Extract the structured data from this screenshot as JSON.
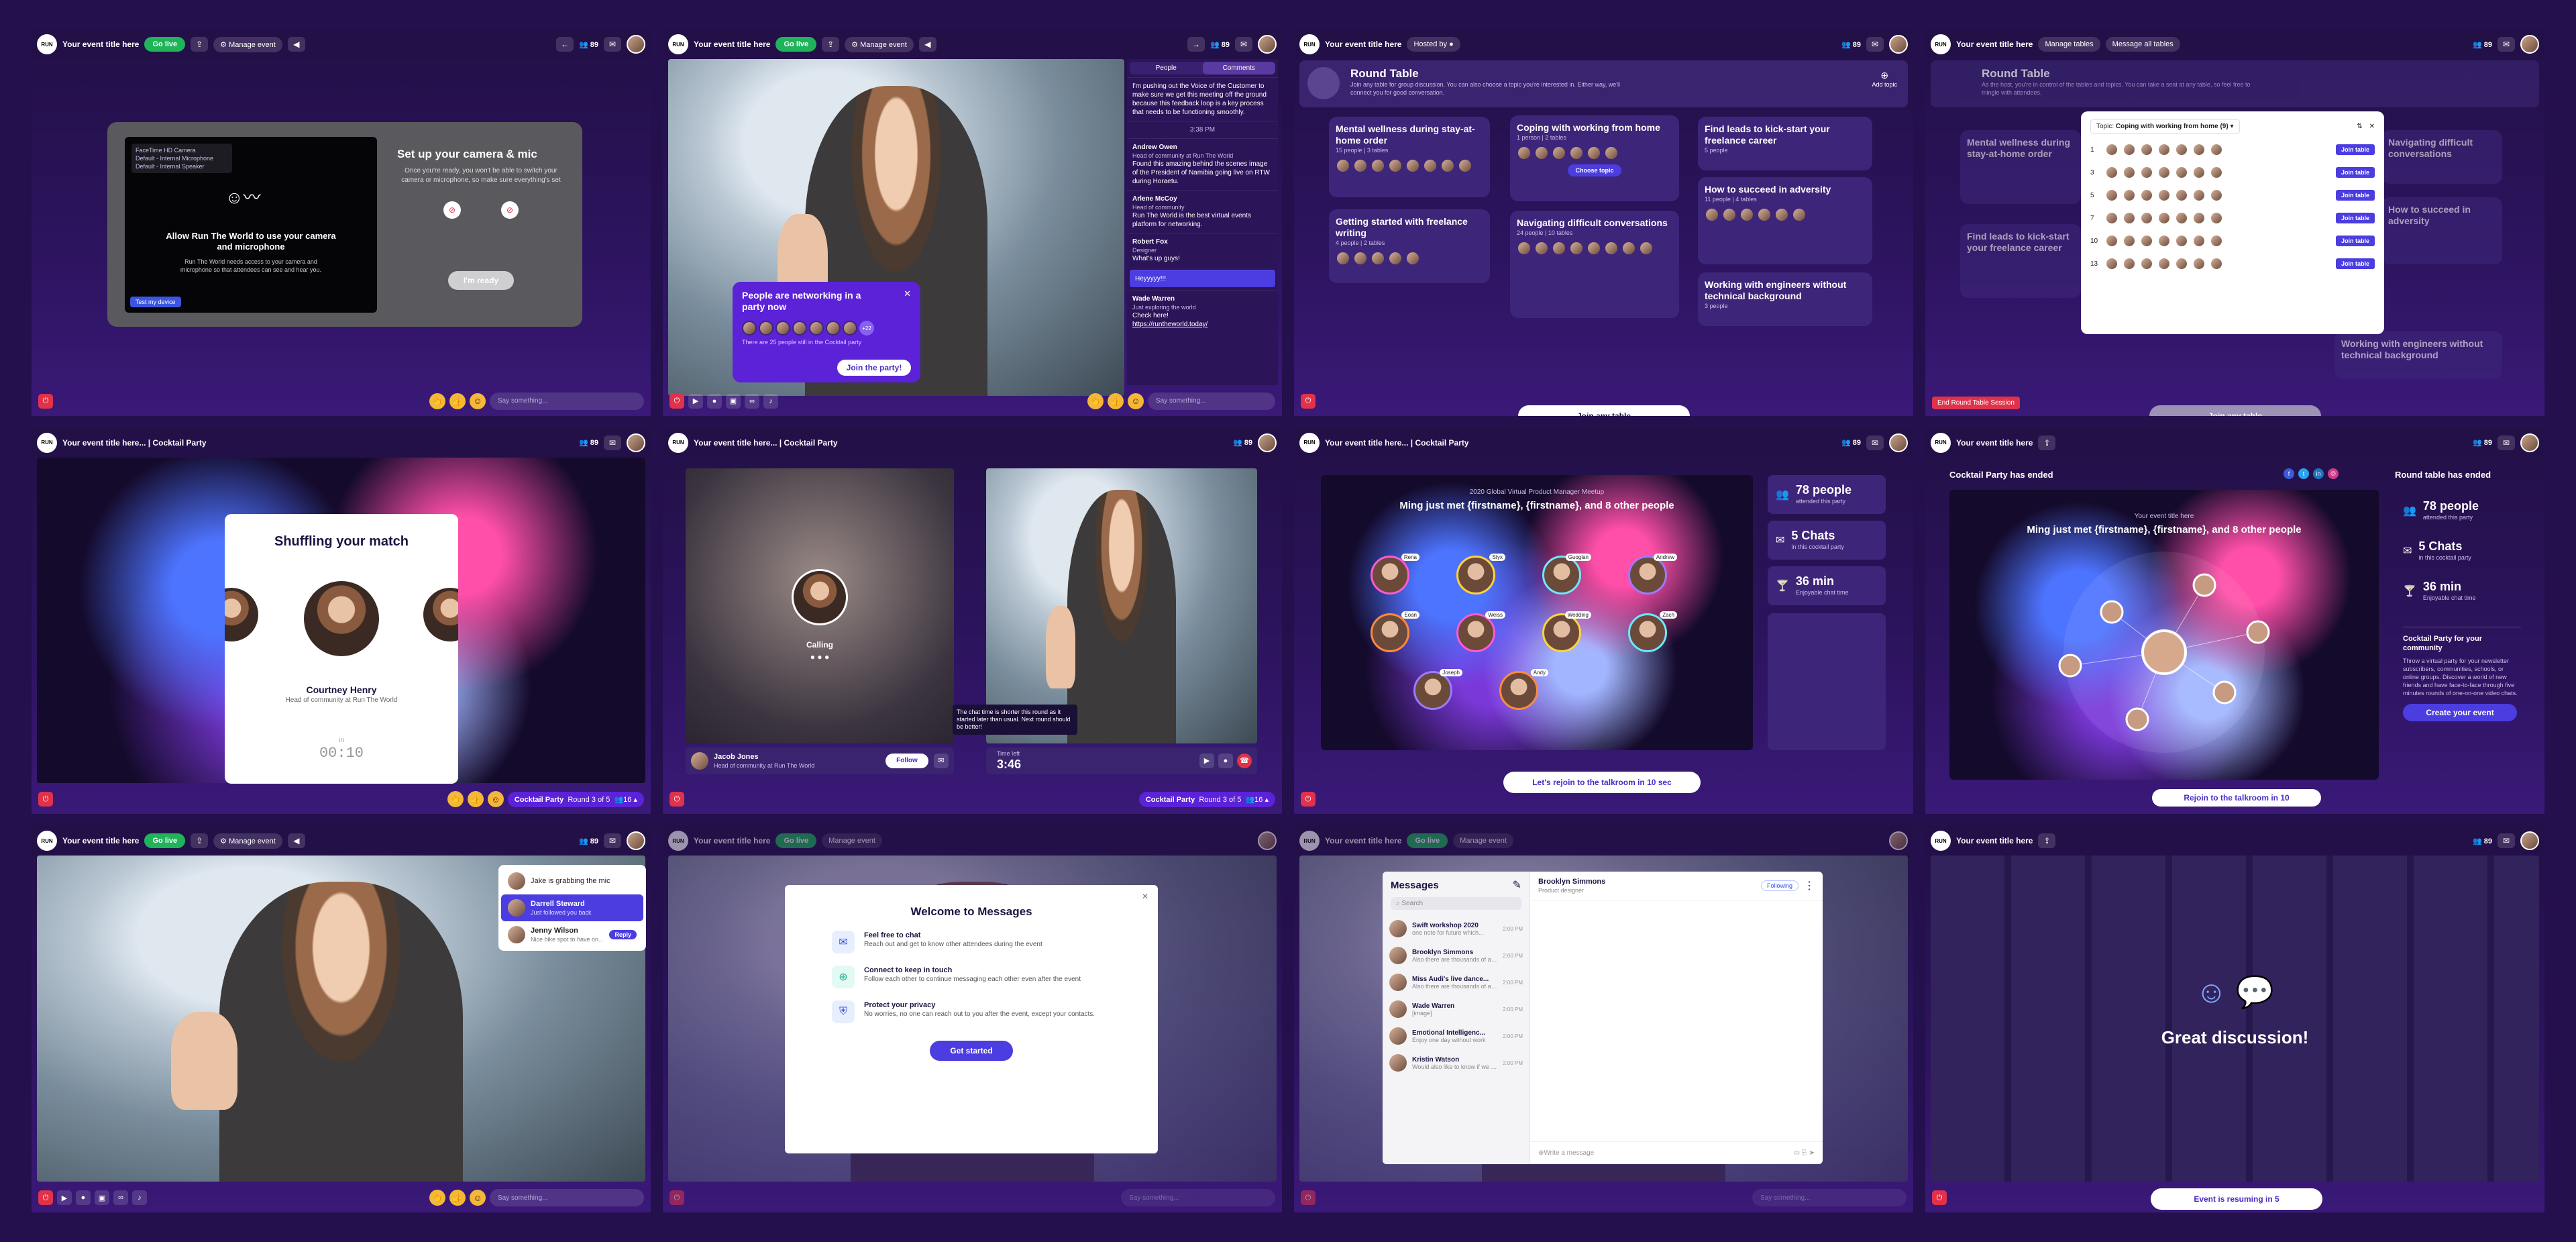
{
  "brand": {
    "logo": "RUN THE WORLD",
    "logo_lines": [
      "RUN",
      "THE",
      "WORLD"
    ]
  },
  "common": {
    "event_title": "Your event title here",
    "event_title_party": "Your event title here... | Cocktail Party",
    "go_live": "Go live",
    "manage_event": "Manage event",
    "attendee_count": "89",
    "say_something": "Say something...",
    "hosted_by": "Hosted by",
    "manage_tables": "Manage tables",
    "message_all_tables": "Message all tables"
  },
  "p1": {
    "devices": [
      "FaceTime HD Camera",
      "Default - Internal Microphone",
      "Default - Internal Speaker"
    ],
    "allow_title": "Allow Run The World to use your camera and microphone",
    "allow_body": "Run The World needs access to your camera and microphone so that attendees can see and hear you.",
    "test_device": "Test my device",
    "setup_title": "Set up your camera & mic",
    "setup_body": "Once you're ready, you won't be able to switch your camera or microphone, so make sure everything's set",
    "ready": "I'm ready"
  },
  "p2": {
    "tabs": [
      "People",
      "Comments"
    ],
    "chat": [
      {
        "name": "",
        "role": "",
        "text": "I'm pushing out the Voice of the Customer to make sure we get this meeting off the ground because this feedback loop is a key process that needs to be functioning smoothly."
      },
      {
        "name": "",
        "role": "",
        "text": "3:38 PM"
      },
      {
        "name": "Andrew Owen",
        "role": "Head of community at Run The World",
        "text": "Found this amazing behind the scenes image of the President of Namibia going live on RTW during Horaetu."
      },
      {
        "name": "Arlene McCoy",
        "role": "Head of community",
        "text": "Run The World is the best virtual events platform for networking."
      },
      {
        "name": "Robert Fox",
        "role": "Designer",
        "text": "What's up guys!"
      },
      {
        "name": "",
        "role": "",
        "text": "Heyyyyy!!!"
      },
      {
        "name": "Wade Warren",
        "role": "Just exploring the world",
        "text": "Check here!"
      }
    ],
    "chat_link": "https://runtheworld.today/",
    "networking_title": "People are networking in a party now",
    "networking_note": "There are 25 people still in the Cocktail party",
    "networking_count": "+22",
    "join_party": "Join the party!"
  },
  "p3": {
    "heading": "Round Table",
    "sub": "Join any table for group discussion. You can also choose a topic you're interested in. Either way, we'll connect you for good conversation.",
    "add_topic": "Add topic",
    "tables": [
      {
        "title": "Mental wellness during stay-at-home order",
        "meta": "15 people | 3 tables"
      },
      {
        "title": "Coping with working from home",
        "meta": "1 person | 2 tables"
      },
      {
        "title": "Find leads to kick-start your freelance career",
        "meta": "5 people"
      },
      {
        "title": "How to succeed in adversity",
        "meta": "11 people | 4 tables"
      },
      {
        "title": "Getting started with freelance writing",
        "meta": "4 people | 2 tables"
      },
      {
        "title": "Navigating difficult conversations",
        "meta": "24 people | 10 tables"
      },
      {
        "title": "Working with engineers without technical background",
        "meta": "3 people"
      }
    ],
    "choose_topic": "Choose topic",
    "join_any": "Join any table"
  },
  "p4": {
    "heading": "Round Table",
    "sub": "As the host, you're in control of the tables and topics. You can take a seat at any table, so feel free to mingle with attendees.",
    "topic_label": "Topic:",
    "topic_value": "Coping with working from home (9)",
    "table_numbers": [
      "1",
      "3",
      "5",
      "7",
      "10",
      "13"
    ],
    "join_table": "Join table",
    "left_titles": [
      "Mental wellness during stay-at-home order",
      "Find leads to kick-start your freelance career"
    ],
    "right_titles": [
      "Navigating difficult conversations",
      "How to succeed in adversity",
      "Working with engineers without technical background"
    ],
    "end_session": "End Round Table Session",
    "join_any": "Join any table"
  },
  "p5": {
    "heading": "Shuffling your match",
    "name": "Courtney Henry",
    "role": "Head of community at Run The World",
    "in": "in",
    "timer": "00:10",
    "party": "Cocktail Party",
    "round": "Round 3 of 5",
    "people": "16"
  },
  "p6": {
    "calling": "Calling",
    "name": "Jacob Jones",
    "role": "Head of community at Run The World",
    "follow": "Follow",
    "tooltip": "The chat time is shorter this round as it started later than usual. Next round should be better!",
    "time_left_label": "Time left",
    "time_left": "3:46",
    "party": "Cocktail Party",
    "round": "Round 3 of 5",
    "people": "16"
  },
  "p7": {
    "event": "2020 Global Virtual Product Manager Meetup",
    "headline": "Ming just met {firstname}, {firstname}, and 8 other people",
    "names": [
      "Rena",
      "Styx",
      "Guoglan",
      "Andrew",
      "Eoan",
      "Weiss",
      "Wedding",
      "Zach",
      "Joseph",
      "Andy"
    ],
    "stats": [
      {
        "value": "78 people",
        "label": "attended this party"
      },
      {
        "value": "5 Chats",
        "label": "in this cocktail party"
      },
      {
        "value": "36 min",
        "label": "Enjoyable chat time"
      }
    ],
    "rejoin": "Let's rejoin to the talkroom in 10 sec"
  },
  "p8": {
    "ended": "Cocktail Party has ended",
    "rt_ended": "Round table has ended",
    "event": "Your event title here",
    "headline": "Ming just met {firstname}, {firstname}, and 8 other people",
    "stats": [
      {
        "value": "78 people",
        "label": "attended this party"
      },
      {
        "value": "5 Chats",
        "label": "in this cocktail party"
      },
      {
        "value": "36 min",
        "label": "Enjoyable chat time"
      }
    ],
    "promo_title": "Cocktail Party for your community",
    "promo_body": "Throw a virtual party for your newsletter subscribers, communities, schools, or online groups. Discover a world of new friends and have face-to-face through five minutes rounds of one-on-one video chats.",
    "create": "Create your event",
    "rejoin": "Rejoin to the talkroom in 10"
  },
  "p9": {
    "queue": [
      {
        "name": "Jake is grabbing the mic",
        "note": ""
      },
      {
        "name": "Darrell Steward",
        "note": "Just followed you back"
      },
      {
        "name": "Jenny Wilson",
        "note": "Nice bike spot to have on..."
      }
    ],
    "reply": "Reply"
  },
  "p10": {
    "title": "Welcome to Messages",
    "features": [
      {
        "title": "Feel free to chat",
        "body": "Reach out and get to know other attendees during the event"
      },
      {
        "title": "Connect to keep in touch",
        "body": "Follow each other to continue messaging each other even after the event"
      },
      {
        "title": "Protect your privacy",
        "body": "No worries, no one can reach out to you after the event, except your contacts."
      }
    ],
    "cta": "Get started"
  },
  "p11": {
    "title": "Messages",
    "search": "Search",
    "threads": [
      {
        "name": "Swift workshop 2020",
        "preview": "one note for future which...",
        "time": "2:00 PM"
      },
      {
        "name": "Brooklyn Simmons",
        "preview": "Also there are thousands of amazing...",
        "time": "2:00 PM"
      },
      {
        "name": "Miss Audi's live dance...",
        "preview": "Also there are thousands of amazing...",
        "time": "2:00 PM"
      },
      {
        "name": "Wade Warren",
        "preview": "[image]",
        "time": "2:00 PM"
      },
      {
        "name": "Emotional Intelligenc...",
        "preview": "Enjoy one day without work",
        "time": "2:00 PM"
      },
      {
        "name": "Kristin Watson",
        "preview": "Would also like to know if we hear...",
        "time": "2:00 PM"
      }
    ],
    "contact": "Brooklyn Simmons",
    "contact_role": "Product designer",
    "following": "Following",
    "write": "Write a message"
  },
  "p12": {
    "headline": "Great discussion!",
    "resume": "Event is resuming in 5"
  },
  "colors": {
    "bg": "#24104d",
    "golive": "#1fb45a",
    "accent": "#4b3de0",
    "card": "#3d2679"
  }
}
